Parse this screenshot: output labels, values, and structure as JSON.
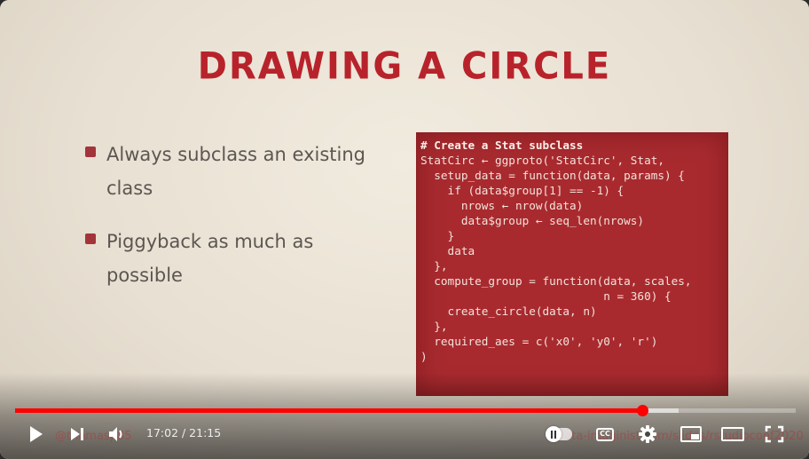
{
  "slide": {
    "title": "DRAWING A CIRCLE",
    "bullets": [
      {
        "text": "Always subclass an existing class"
      },
      {
        "text": "Piggyback as much as possible"
      }
    ],
    "code_lines": [
      "# Create a Stat subclass",
      "StatCirc ← ggproto('StatCirc', Stat,",
      "  setup_data = function(data, params) {",
      "    if (data$group[1] == -1) {",
      "      nrows ← nrow(data)",
      "      data$group ← seq_len(nrows)",
      "    }",
      "    data",
      "  },",
      "  compute_group = function(data, scales,",
      "                           n = 360) {",
      "    create_circle(data, n)",
      "  },",
      "  required_aes = c('x0', 'y0', 'r')",
      ")"
    ],
    "footer_left": "@thomasp85",
    "footer_right": "data-imaginist.com/slides/rstudioconf2020"
  },
  "player": {
    "time_display": "17:02 / 21:15",
    "progress_fraction": 0.8029,
    "buffered_fraction": 0.85,
    "cc_label": "CC",
    "accent_color": "#ff0000",
    "icons": [
      "play-icon",
      "next-icon",
      "volume-icon",
      "autoplay-toggle-icon",
      "captions-icon",
      "settings-icon",
      "miniplayer-icon",
      "theater-icon",
      "fullscreen-icon"
    ]
  }
}
